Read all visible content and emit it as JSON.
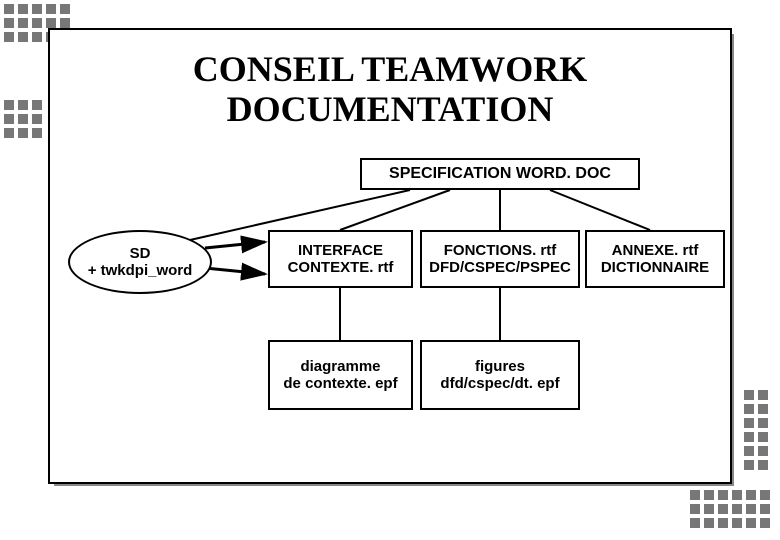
{
  "title_line1": "CONSEIL TEAMWORK",
  "title_line2": "DOCUMENTATION",
  "spec_box": "SPECIFICATION WORD. DOC",
  "sd_line1": "SD",
  "sd_line2": "+ twkdpi_word",
  "interface_line1": "INTERFACE",
  "interface_line2": "CONTEXTE. rtf",
  "fonctions_line1": "FONCTIONS. rtf",
  "fonctions_line2": "DFD/CSPEC/PSPEC",
  "annexe_line1": "ANNEXE. rtf",
  "annexe_line2": "DICTIONNAIRE",
  "diag_line1": "diagramme",
  "diag_line2": "de contexte. epf",
  "fig_line1": "figures",
  "fig_line2": "dfd/cspec/dt. epf"
}
